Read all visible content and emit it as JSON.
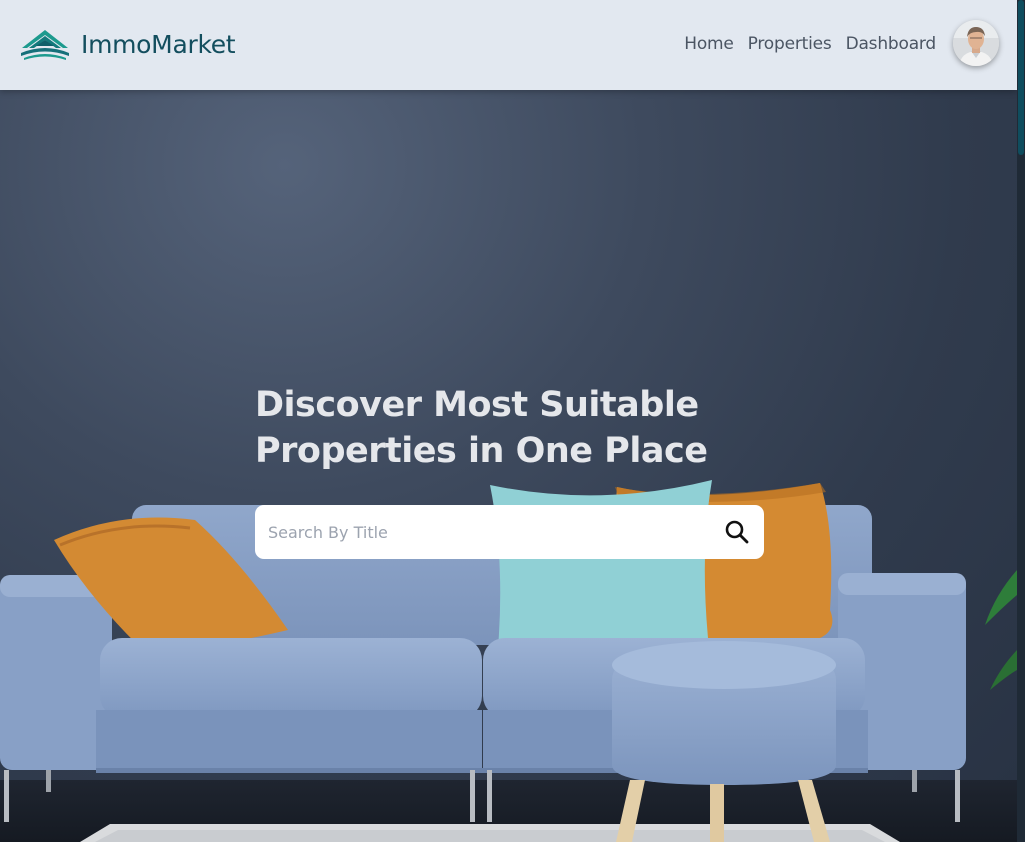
{
  "brand": {
    "name": "ImmoMarket",
    "logo_icon": "house-roof-logo-icon"
  },
  "nav": {
    "links": [
      {
        "label": "Home"
      },
      {
        "label": "Properties"
      },
      {
        "label": "Dashboard"
      }
    ],
    "avatar_icon": "user-avatar"
  },
  "hero": {
    "title_line1": "Discover Most Suitable",
    "title_line2": "Properties in One Place",
    "search": {
      "placeholder": "Search By Title",
      "value": "",
      "button_icon": "search-icon"
    }
  },
  "colors": {
    "navbar_bg": "#e2e8f0",
    "brand": "#134e5e",
    "nav_text": "#4b5563",
    "hero_title": "#e5e7eb",
    "sofa": "#8aa3c8",
    "pillow_orange": "#d3872f",
    "pillow_teal": "#8fd0d4"
  }
}
